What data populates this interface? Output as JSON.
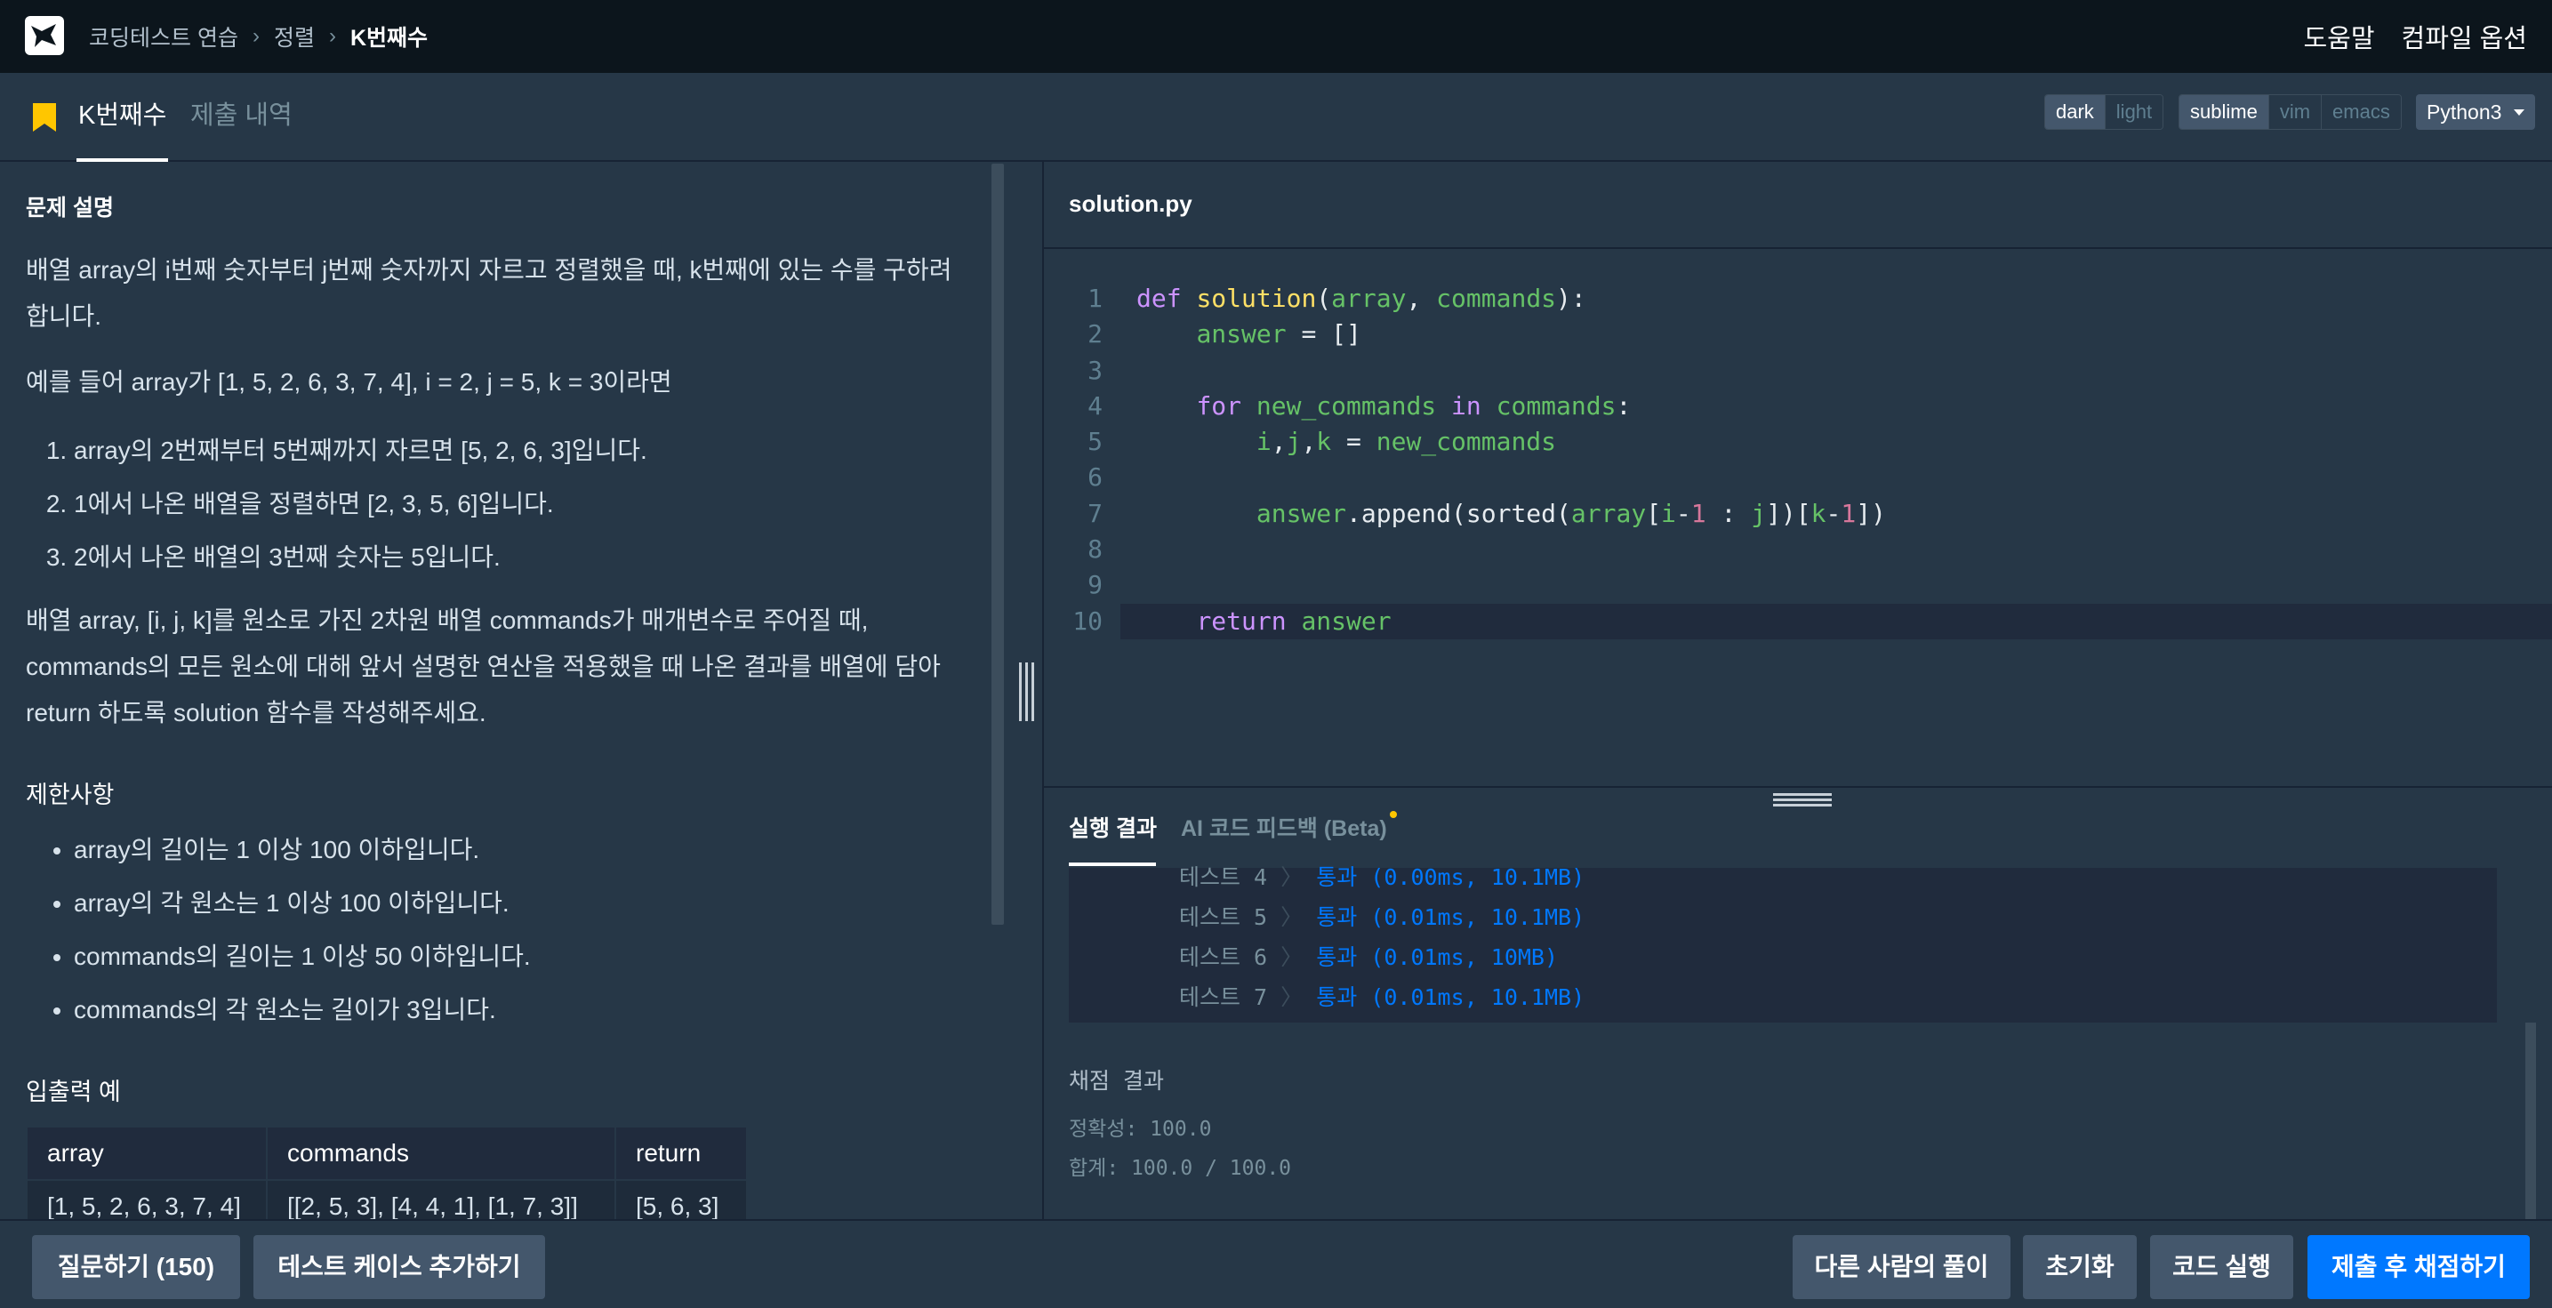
{
  "nav": {
    "breadcrumbs": [
      "코딩테스트 연습",
      "정렬",
      "K번째수"
    ],
    "help": "도움말",
    "compile_options": "컴파일 옵션"
  },
  "tabs": {
    "problem": "K번째수",
    "submissions": "제출 내역"
  },
  "toolbar": {
    "themes": [
      "dark",
      "light"
    ],
    "keymaps": [
      "sublime",
      "vim",
      "emacs"
    ],
    "language": "Python3"
  },
  "problem": {
    "desc_title": "문제 설명",
    "desc_p1": "배열 array의 i번째 숫자부터 j번째 숫자까지 자르고 정렬했을 때, k번째에 있는 수를 구하려 합니다.",
    "desc_p2": "예를 들어 array가 [1, 5, 2, 6, 3, 7, 4], i = 2, j = 5, k = 3이라면",
    "steps": [
      "array의 2번째부터 5번째까지 자르면 [5, 2, 6, 3]입니다.",
      "1에서 나온 배열을 정렬하면 [2, 3, 5, 6]입니다.",
      "2에서 나온 배열의 3번째 숫자는 5입니다."
    ],
    "desc_p3": "배열 array, [i, j, k]를 원소로 가진 2차원 배열 commands가 매개변수로 주어질 때, commands의 모든 원소에 대해 앞서 설명한 연산을 적용했을 때 나온 결과를 배열에 담아 return 하도록 solution 함수를 작성해주세요.",
    "limits_title": "제한사항",
    "limits": [
      "array의 길이는 1 이상 100 이하입니다.",
      "array의 각 원소는 1 이상 100 이하입니다.",
      "commands의 길이는 1 이상 50 이하입니다.",
      "commands의 각 원소는 길이가 3입니다."
    ],
    "io_title": "입출력 예",
    "io_headers": [
      "array",
      "commands",
      "return"
    ],
    "io_rows": [
      [
        "[1, 5, 2, 6, 3, 7, 4]",
        "[[2, 5, 3], [4, 4, 1], [1, 7, 3]]",
        "[5, 6, 3]"
      ]
    ]
  },
  "editor": {
    "filename": "solution.py",
    "line_numbers": [
      "1",
      "2",
      "3",
      "4",
      "5",
      "6",
      "7",
      "8",
      "9",
      "10"
    ]
  },
  "results": {
    "tab_run": "실행 결과",
    "tab_ai": "AI 코드 피드백 (Beta)",
    "tests": [
      {
        "label": "테스트 4",
        "result": "통과 (0.00ms, 10.1MB)"
      },
      {
        "label": "테스트 5",
        "result": "통과 (0.01ms, 10.1MB)"
      },
      {
        "label": "테스트 6",
        "result": "통과 (0.01ms, 10MB)"
      },
      {
        "label": "테스트 7",
        "result": "통과 (0.01ms, 10.1MB)"
      }
    ],
    "grade_title": "채점 결과",
    "accuracy": "정확성: 100.0",
    "total": "합계: 100.0 / 100.0"
  },
  "bottom": {
    "question": "질문하기 (150)",
    "add_testcase": "테스트 케이스 추가하기",
    "others": "다른 사람의 풀이",
    "reset": "초기화",
    "run": "코드 실행",
    "submit": "제출 후 채점하기"
  },
  "colors": {
    "accent": "#0078ff",
    "bg": "#263747",
    "topbar": "#0c151c",
    "bookmark": "#ffc600"
  }
}
